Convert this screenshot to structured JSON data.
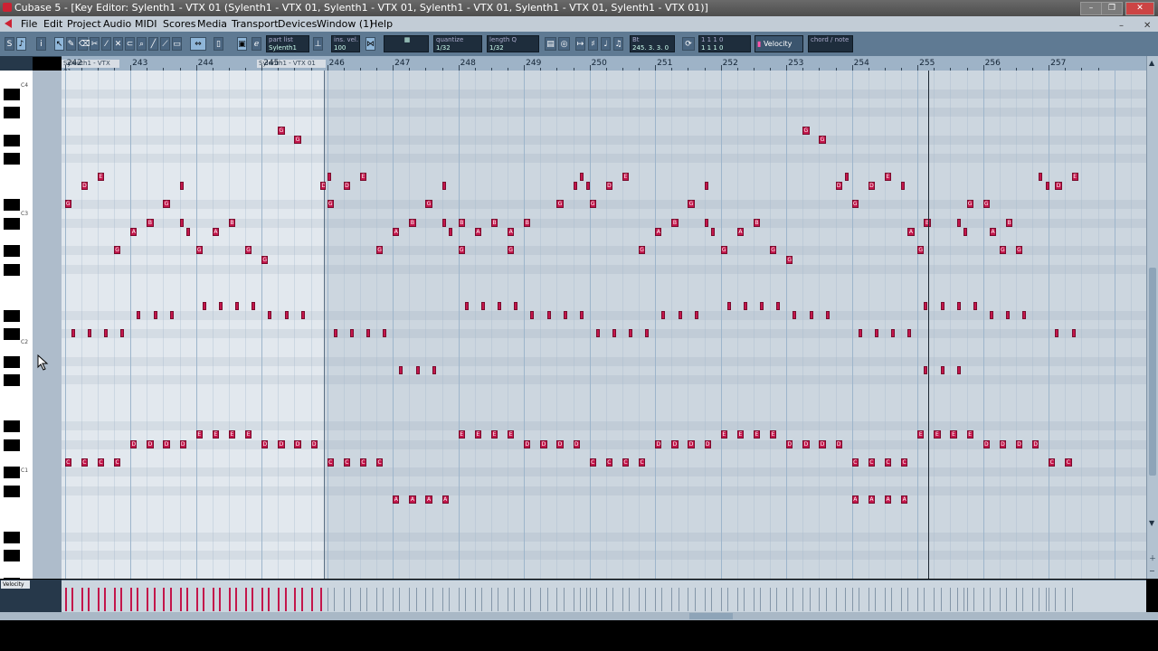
{
  "window": {
    "title": "Cubase 5 - [Key Editor: Sylenth1 - VTX 01 (Sylenth1 - VTX 01, Sylenth1 - VTX 01, Sylenth1 - VTX 01, Sylenth1 - VTX 01, Sylenth1 - VTX 01)]",
    "minimize": "–",
    "maximize": "❐",
    "close": "✕"
  },
  "menu": {
    "items": [
      "File",
      "Edit",
      "Project",
      "Audio",
      "MIDI",
      "Scores",
      "Media",
      "Transport",
      "Devices",
      "Window (1)",
      "Help"
    ],
    "sub_minimize": "–",
    "sub_close": "✕"
  },
  "toolbar": {
    "part_list_label": "part list",
    "part_list_value": "Sylenth1",
    "ins_vel_label": "ins. vel.",
    "ins_vel_value": "100",
    "quantize_label": "quantize",
    "quantize_value": "1/32",
    "length_label": "length Q",
    "length_value": "1/32",
    "position_label": "Bt",
    "position_value": "245. 3. 3. 0",
    "length_display": "1 1 1 0",
    "length_display2": "1 1 1 0",
    "controller": "Velocity",
    "chord_label": "chord / note"
  },
  "ruler": {
    "bars": [
      "242",
      "243",
      "244",
      "245",
      "246",
      "247",
      "248",
      "249",
      "250",
      "251",
      "252",
      "253",
      "254",
      "255",
      "256",
      "257"
    ],
    "parts": [
      "Sylenth1 - VTX 01",
      "Sylenth1 - VTX 01"
    ]
  },
  "keyboard": {
    "labels": [
      "C4",
      "C3",
      "C2",
      "C1"
    ]
  },
  "notes": [
    {
      "bar": 242.0,
      "len": 0.1,
      "row": 14,
      "label": "G"
    },
    {
      "bar": 242.25,
      "len": 0.1,
      "row": 12,
      "label": "D"
    },
    {
      "bar": 242.5,
      "len": 0.1,
      "row": 11,
      "label": "E"
    },
    {
      "bar": 243.5,
      "len": 0.1,
      "row": 14,
      "label": "G"
    },
    {
      "bar": 243.75,
      "len": 0.04,
      "row": 12,
      "label": ""
    },
    {
      "bar": 243.0,
      "len": 0.1,
      "row": 17,
      "label": "A"
    },
    {
      "bar": 243.25,
      "len": 0.1,
      "row": 16,
      "label": "B"
    },
    {
      "bar": 243.75,
      "len": 0.04,
      "row": 16,
      "label": ""
    },
    {
      "bar": 243.85,
      "len": 0.04,
      "row": 17,
      "label": ""
    },
    {
      "bar": 244.25,
      "len": 0.1,
      "row": 17,
      "label": "A"
    },
    {
      "bar": 244.5,
      "len": 0.1,
      "row": 16,
      "label": "B"
    },
    {
      "bar": 242.75,
      "len": 0.1,
      "row": 19,
      "label": "G"
    },
    {
      "bar": 244.0,
      "len": 0.1,
      "row": 19,
      "label": "G"
    },
    {
      "bar": 244.75,
      "len": 0.1,
      "row": 19,
      "label": "G"
    },
    {
      "bar": 245.0,
      "len": 0.1,
      "row": 20,
      "label": "G"
    },
    {
      "bar": 245.25,
      "len": 0.1,
      "row": 6,
      "label": "G"
    },
    {
      "bar": 245.5,
      "len": 0.1,
      "row": 7,
      "label": "G"
    },
    {
      "bar": 245.9,
      "len": 0.08,
      "row": 12,
      "label": "D"
    },
    {
      "bar": 246.0,
      "len": 0.04,
      "row": 11,
      "label": ""
    },
    {
      "bar": 242.1,
      "len": 0.04,
      "row": 28,
      "label": ""
    },
    {
      "bar": 242.35,
      "len": 0.04,
      "row": 28,
      "label": ""
    },
    {
      "bar": 242.6,
      "len": 0.04,
      "row": 28,
      "label": ""
    },
    {
      "bar": 242.85,
      "len": 0.04,
      "row": 28,
      "label": ""
    },
    {
      "bar": 243.1,
      "len": 0.04,
      "row": 26,
      "label": ""
    },
    {
      "bar": 243.35,
      "len": 0.04,
      "row": 26,
      "label": ""
    },
    {
      "bar": 243.6,
      "len": 0.04,
      "row": 26,
      "label": ""
    },
    {
      "bar": 244.1,
      "len": 0.04,
      "row": 25,
      "label": ""
    },
    {
      "bar": 244.35,
      "len": 0.04,
      "row": 25,
      "label": ""
    },
    {
      "bar": 244.6,
      "len": 0.04,
      "row": 25,
      "label": ""
    },
    {
      "bar": 244.85,
      "len": 0.04,
      "row": 25,
      "label": ""
    },
    {
      "bar": 245.1,
      "len": 0.04,
      "row": 26,
      "label": ""
    },
    {
      "bar": 245.35,
      "len": 0.04,
      "row": 26,
      "label": ""
    },
    {
      "bar": 245.6,
      "len": 0.04,
      "row": 26,
      "label": ""
    },
    {
      "bar": 243.0,
      "len": 0.1,
      "row": 40,
      "label": "D"
    },
    {
      "bar": 243.25,
      "len": 0.1,
      "row": 40,
      "label": "D"
    },
    {
      "bar": 243.5,
      "len": 0.1,
      "row": 40,
      "label": "D"
    },
    {
      "bar": 243.75,
      "len": 0.1,
      "row": 40,
      "label": "D"
    },
    {
      "bar": 244.0,
      "len": 0.1,
      "row": 39,
      "label": "E"
    },
    {
      "bar": 244.25,
      "len": 0.1,
      "row": 39,
      "label": "E"
    },
    {
      "bar": 244.5,
      "len": 0.1,
      "row": 39,
      "label": "E"
    },
    {
      "bar": 244.75,
      "len": 0.1,
      "row": 39,
      "label": "E"
    },
    {
      "bar": 245.0,
      "len": 0.1,
      "row": 40,
      "label": "D"
    },
    {
      "bar": 245.25,
      "len": 0.1,
      "row": 40,
      "label": "D"
    },
    {
      "bar": 245.5,
      "len": 0.1,
      "row": 40,
      "label": "D"
    },
    {
      "bar": 245.75,
      "len": 0.1,
      "row": 40,
      "label": "D"
    },
    {
      "bar": 242.0,
      "len": 0.1,
      "row": 42,
      "label": "C"
    },
    {
      "bar": 242.25,
      "len": 0.1,
      "row": 42,
      "label": "C"
    },
    {
      "bar": 242.5,
      "len": 0.1,
      "row": 42,
      "label": "C"
    },
    {
      "bar": 242.75,
      "len": 0.1,
      "row": 42,
      "label": "C"
    },
    {
      "bar": 246.0,
      "len": 0.1,
      "row": 14,
      "label": "G"
    },
    {
      "bar": 246.25,
      "len": 0.1,
      "row": 12,
      "label": "D"
    },
    {
      "bar": 246.5,
      "len": 0.1,
      "row": 11,
      "label": "E"
    },
    {
      "bar": 247.5,
      "len": 0.1,
      "row": 14,
      "label": "G"
    },
    {
      "bar": 247.75,
      "len": 0.04,
      "row": 12,
      "label": ""
    },
    {
      "bar": 247.0,
      "len": 0.1,
      "row": 17,
      "label": "A"
    },
    {
      "bar": 247.25,
      "len": 0.1,
      "row": 16,
      "label": "B"
    },
    {
      "bar": 247.75,
      "len": 0.04,
      "row": 16,
      "label": ""
    },
    {
      "bar": 247.85,
      "len": 0.04,
      "row": 17,
      "label": ""
    },
    {
      "bar": 248.25,
      "len": 0.1,
      "row": 17,
      "label": "A"
    },
    {
      "bar": 248.5,
      "len": 0.1,
      "row": 16,
      "label": "B"
    },
    {
      "bar": 248.0,
      "len": 0.1,
      "row": 16,
      "label": "B"
    },
    {
      "bar": 248.75,
      "len": 0.1,
      "row": 17,
      "label": "A"
    },
    {
      "bar": 249.0,
      "len": 0.1,
      "row": 16,
      "label": "B"
    },
    {
      "bar": 246.75,
      "len": 0.1,
      "row": 19,
      "label": "G"
    },
    {
      "bar": 248.0,
      "len": 0.1,
      "row": 19,
      "label": "G"
    },
    {
      "bar": 248.75,
      "len": 0.1,
      "row": 19,
      "label": "G"
    },
    {
      "bar": 249.5,
      "len": 0.1,
      "row": 14,
      "label": "G"
    },
    {
      "bar": 249.75,
      "len": 0.04,
      "row": 12,
      "label": ""
    },
    {
      "bar": 249.85,
      "len": 0.04,
      "row": 11,
      "label": ""
    },
    {
      "bar": 249.95,
      "len": 0.04,
      "row": 12,
      "label": ""
    },
    {
      "bar": 250.25,
      "len": 0.1,
      "row": 12,
      "label": "D"
    },
    {
      "bar": 250.5,
      "len": 0.1,
      "row": 11,
      "label": "E"
    },
    {
      "bar": 246.1,
      "len": 0.04,
      "row": 28,
      "label": ""
    },
    {
      "bar": 246.35,
      "len": 0.04,
      "row": 28,
      "label": ""
    },
    {
      "bar": 246.6,
      "len": 0.04,
      "row": 28,
      "label": ""
    },
    {
      "bar": 246.85,
      "len": 0.04,
      "row": 28,
      "label": ""
    },
    {
      "bar": 247.1,
      "len": 0.04,
      "row": 32,
      "label": ""
    },
    {
      "bar": 247.35,
      "len": 0.04,
      "row": 32,
      "label": ""
    },
    {
      "bar": 247.6,
      "len": 0.04,
      "row": 32,
      "label": ""
    },
    {
      "bar": 248.1,
      "len": 0.04,
      "row": 25,
      "label": ""
    },
    {
      "bar": 248.35,
      "len": 0.04,
      "row": 25,
      "label": ""
    },
    {
      "bar": 248.6,
      "len": 0.04,
      "row": 25,
      "label": ""
    },
    {
      "bar": 248.85,
      "len": 0.04,
      "row": 25,
      "label": ""
    },
    {
      "bar": 249.1,
      "len": 0.04,
      "row": 26,
      "label": ""
    },
    {
      "bar": 249.35,
      "len": 0.04,
      "row": 26,
      "label": ""
    },
    {
      "bar": 249.6,
      "len": 0.04,
      "row": 26,
      "label": ""
    },
    {
      "bar": 249.85,
      "len": 0.04,
      "row": 26,
      "label": ""
    },
    {
      "bar": 248.0,
      "len": 0.1,
      "row": 39,
      "label": "E"
    },
    {
      "bar": 248.25,
      "len": 0.1,
      "row": 39,
      "label": "E"
    },
    {
      "bar": 248.5,
      "len": 0.1,
      "row": 39,
      "label": "E"
    },
    {
      "bar": 248.75,
      "len": 0.1,
      "row": 39,
      "label": "E"
    },
    {
      "bar": 249.0,
      "len": 0.1,
      "row": 40,
      "label": "D"
    },
    {
      "bar": 249.25,
      "len": 0.1,
      "row": 40,
      "label": "D"
    },
    {
      "bar": 249.5,
      "len": 0.1,
      "row": 40,
      "label": "D"
    },
    {
      "bar": 249.75,
      "len": 0.1,
      "row": 40,
      "label": "D"
    },
    {
      "bar": 246.0,
      "len": 0.1,
      "row": 42,
      "label": "C"
    },
    {
      "bar": 246.25,
      "len": 0.1,
      "row": 42,
      "label": "C"
    },
    {
      "bar": 246.5,
      "len": 0.1,
      "row": 42,
      "label": "C"
    },
    {
      "bar": 246.75,
      "len": 0.1,
      "row": 42,
      "label": "C"
    },
    {
      "bar": 247.0,
      "len": 0.1,
      "row": 46,
      "label": "A"
    },
    {
      "bar": 247.25,
      "len": 0.1,
      "row": 46,
      "label": "A"
    },
    {
      "bar": 247.5,
      "len": 0.1,
      "row": 46,
      "label": "A"
    },
    {
      "bar": 247.75,
      "len": 0.1,
      "row": 46,
      "label": "A"
    },
    {
      "bar": 250.0,
      "len": 0.1,
      "row": 14,
      "label": "G"
    },
    {
      "bar": 251.5,
      "len": 0.1,
      "row": 14,
      "label": "G"
    },
    {
      "bar": 251.75,
      "len": 0.04,
      "row": 12,
      "label": ""
    },
    {
      "bar": 251.0,
      "len": 0.1,
      "row": 17,
      "label": "A"
    },
    {
      "bar": 251.25,
      "len": 0.1,
      "row": 16,
      "label": "B"
    },
    {
      "bar": 251.75,
      "len": 0.04,
      "row": 16,
      "label": ""
    },
    {
      "bar": 251.85,
      "len": 0.04,
      "row": 17,
      "label": ""
    },
    {
      "bar": 252.25,
      "len": 0.1,
      "row": 17,
      "label": "A"
    },
    {
      "bar": 252.5,
      "len": 0.1,
      "row": 16,
      "label": "B"
    },
    {
      "bar": 250.75,
      "len": 0.1,
      "row": 19,
      "label": "G"
    },
    {
      "bar": 252.0,
      "len": 0.1,
      "row": 19,
      "label": "G"
    },
    {
      "bar": 252.75,
      "len": 0.1,
      "row": 19,
      "label": "G"
    },
    {
      "bar": 253.0,
      "len": 0.1,
      "row": 20,
      "label": "G"
    },
    {
      "bar": 253.25,
      "len": 0.1,
      "row": 6,
      "label": "G"
    },
    {
      "bar": 253.5,
      "len": 0.1,
      "row": 7,
      "label": "G"
    },
    {
      "bar": 253.75,
      "len": 0.1,
      "row": 12,
      "label": "D"
    },
    {
      "bar": 253.9,
      "len": 0.04,
      "row": 11,
      "label": ""
    },
    {
      "bar": 254.25,
      "len": 0.1,
      "row": 12,
      "label": "D"
    },
    {
      "bar": 254.5,
      "len": 0.1,
      "row": 11,
      "label": "E"
    },
    {
      "bar": 250.1,
      "len": 0.04,
      "row": 28,
      "label": ""
    },
    {
      "bar": 250.35,
      "len": 0.04,
      "row": 28,
      "label": ""
    },
    {
      "bar": 250.6,
      "len": 0.04,
      "row": 28,
      "label": ""
    },
    {
      "bar": 250.85,
      "len": 0.04,
      "row": 28,
      "label": ""
    },
    {
      "bar": 251.1,
      "len": 0.04,
      "row": 26,
      "label": ""
    },
    {
      "bar": 251.35,
      "len": 0.04,
      "row": 26,
      "label": ""
    },
    {
      "bar": 251.6,
      "len": 0.04,
      "row": 26,
      "label": ""
    },
    {
      "bar": 252.1,
      "len": 0.04,
      "row": 25,
      "label": ""
    },
    {
      "bar": 252.35,
      "len": 0.04,
      "row": 25,
      "label": ""
    },
    {
      "bar": 252.6,
      "len": 0.04,
      "row": 25,
      "label": ""
    },
    {
      "bar": 252.85,
      "len": 0.04,
      "row": 25,
      "label": ""
    },
    {
      "bar": 253.1,
      "len": 0.04,
      "row": 26,
      "label": ""
    },
    {
      "bar": 253.35,
      "len": 0.04,
      "row": 26,
      "label": ""
    },
    {
      "bar": 253.6,
      "len": 0.04,
      "row": 26,
      "label": ""
    },
    {
      "bar": 251.0,
      "len": 0.1,
      "row": 40,
      "label": "D"
    },
    {
      "bar": 251.25,
      "len": 0.1,
      "row": 40,
      "label": "D"
    },
    {
      "bar": 251.5,
      "len": 0.1,
      "row": 40,
      "label": "D"
    },
    {
      "bar": 251.75,
      "len": 0.1,
      "row": 40,
      "label": "D"
    },
    {
      "bar": 252.0,
      "len": 0.1,
      "row": 39,
      "label": "E"
    },
    {
      "bar": 252.25,
      "len": 0.1,
      "row": 39,
      "label": "E"
    },
    {
      "bar": 252.5,
      "len": 0.1,
      "row": 39,
      "label": "E"
    },
    {
      "bar": 252.75,
      "len": 0.1,
      "row": 39,
      "label": "E"
    },
    {
      "bar": 253.0,
      "len": 0.1,
      "row": 40,
      "label": "D"
    },
    {
      "bar": 253.25,
      "len": 0.1,
      "row": 40,
      "label": "D"
    },
    {
      "bar": 253.5,
      "len": 0.1,
      "row": 40,
      "label": "D"
    },
    {
      "bar": 253.75,
      "len": 0.1,
      "row": 40,
      "label": "D"
    },
    {
      "bar": 250.0,
      "len": 0.1,
      "row": 42,
      "label": "C"
    },
    {
      "bar": 250.25,
      "len": 0.1,
      "row": 42,
      "label": "C"
    },
    {
      "bar": 250.5,
      "len": 0.1,
      "row": 42,
      "label": "C"
    },
    {
      "bar": 250.75,
      "len": 0.1,
      "row": 42,
      "label": "C"
    },
    {
      "bar": 254.0,
      "len": 0.1,
      "row": 14,
      "label": "G"
    },
    {
      "bar": 254.75,
      "len": 0.04,
      "row": 12,
      "label": ""
    },
    {
      "bar": 255.75,
      "len": 0.1,
      "row": 14,
      "label": "G"
    },
    {
      "bar": 256.0,
      "len": 0.1,
      "row": 14,
      "label": "G"
    },
    {
      "bar": 254.85,
      "len": 0.1,
      "row": 17,
      "label": "A"
    },
    {
      "bar": 255.1,
      "len": 0.1,
      "row": 16,
      "label": "B"
    },
    {
      "bar": 255.6,
      "len": 0.04,
      "row": 16,
      "label": ""
    },
    {
      "bar": 255.7,
      "len": 0.04,
      "row": 17,
      "label": ""
    },
    {
      "bar": 256.1,
      "len": 0.1,
      "row": 17,
      "label": "A"
    },
    {
      "bar": 256.35,
      "len": 0.1,
      "row": 16,
      "label": "B"
    },
    {
      "bar": 255.0,
      "len": 0.1,
      "row": 19,
      "label": "G"
    },
    {
      "bar": 256.25,
      "len": 0.1,
      "row": 19,
      "label": "G"
    },
    {
      "bar": 256.5,
      "len": 0.1,
      "row": 19,
      "label": "G"
    },
    {
      "bar": 256.85,
      "len": 0.04,
      "row": 11,
      "label": ""
    },
    {
      "bar": 256.95,
      "len": 0.04,
      "row": 12,
      "label": ""
    },
    {
      "bar": 257.1,
      "len": 0.1,
      "row": 12,
      "label": "D"
    },
    {
      "bar": 257.35,
      "len": 0.1,
      "row": 11,
      "label": "E"
    },
    {
      "bar": 254.1,
      "len": 0.04,
      "row": 28,
      "label": ""
    },
    {
      "bar": 254.35,
      "len": 0.04,
      "row": 28,
      "label": ""
    },
    {
      "bar": 254.6,
      "len": 0.04,
      "row": 28,
      "label": ""
    },
    {
      "bar": 254.85,
      "len": 0.04,
      "row": 28,
      "label": ""
    },
    {
      "bar": 255.1,
      "len": 0.04,
      "row": 32,
      "label": ""
    },
    {
      "bar": 255.35,
      "len": 0.04,
      "row": 32,
      "label": ""
    },
    {
      "bar": 255.6,
      "len": 0.04,
      "row": 32,
      "label": ""
    },
    {
      "bar": 255.1,
      "len": 0.04,
      "row": 25,
      "label": ""
    },
    {
      "bar": 255.35,
      "len": 0.04,
      "row": 25,
      "label": ""
    },
    {
      "bar": 255.6,
      "len": 0.04,
      "row": 25,
      "label": ""
    },
    {
      "bar": 255.85,
      "len": 0.04,
      "row": 25,
      "label": ""
    },
    {
      "bar": 256.1,
      "len": 0.04,
      "row": 26,
      "label": ""
    },
    {
      "bar": 256.35,
      "len": 0.04,
      "row": 26,
      "label": ""
    },
    {
      "bar": 256.6,
      "len": 0.04,
      "row": 26,
      "label": ""
    },
    {
      "bar": 257.1,
      "len": 0.04,
      "row": 28,
      "label": ""
    },
    {
      "bar": 257.35,
      "len": 0.04,
      "row": 28,
      "label": ""
    },
    {
      "bar": 255.0,
      "len": 0.1,
      "row": 39,
      "label": "E"
    },
    {
      "bar": 255.25,
      "len": 0.1,
      "row": 39,
      "label": "E"
    },
    {
      "bar": 255.5,
      "len": 0.1,
      "row": 39,
      "label": "E"
    },
    {
      "bar": 255.75,
      "len": 0.1,
      "row": 39,
      "label": "E"
    },
    {
      "bar": 256.0,
      "len": 0.1,
      "row": 40,
      "label": "D"
    },
    {
      "bar": 256.25,
      "len": 0.1,
      "row": 40,
      "label": "D"
    },
    {
      "bar": 256.5,
      "len": 0.1,
      "row": 40,
      "label": "D"
    },
    {
      "bar": 256.75,
      "len": 0.1,
      "row": 40,
      "label": "D"
    },
    {
      "bar": 254.0,
      "len": 0.1,
      "row": 42,
      "label": "C"
    },
    {
      "bar": 254.25,
      "len": 0.1,
      "row": 42,
      "label": "C"
    },
    {
      "bar": 254.5,
      "len": 0.1,
      "row": 42,
      "label": "C"
    },
    {
      "bar": 254.75,
      "len": 0.1,
      "row": 42,
      "label": "C"
    },
    {
      "bar": 257.0,
      "len": 0.1,
      "row": 42,
      "label": "C"
    },
    {
      "bar": 257.25,
      "len": 0.1,
      "row": 42,
      "label": "C"
    },
    {
      "bar": 254.0,
      "len": 0.1,
      "row": 46,
      "label": "A"
    },
    {
      "bar": 254.25,
      "len": 0.1,
      "row": 46,
      "label": "A"
    },
    {
      "bar": 254.5,
      "len": 0.1,
      "row": 46,
      "label": "A"
    },
    {
      "bar": 254.75,
      "len": 0.1,
      "row": 46,
      "label": "A"
    }
  ],
  "controller_lane": {
    "selector": "Velocity"
  },
  "colors": {
    "note": "#c3164b",
    "grid": "#ccd6df",
    "selected_region": "#e2e8ee"
  }
}
